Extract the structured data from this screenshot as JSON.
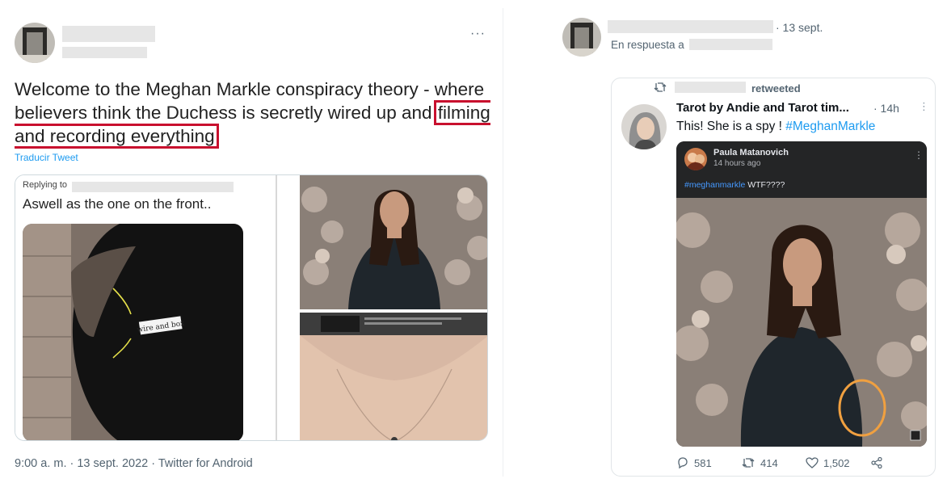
{
  "left_tweet": {
    "more_label": "···",
    "text_before": "Welcome to the Meghan Markle conspiracy theory - where believers think the Duchess is secretly wired up and ",
    "text_highlight": "filming and recording everything",
    "translate_label": "Traducir Tweet",
    "media": {
      "replying_to_label": "Replying to",
      "reply_text": "Aswell as the one on the front..",
      "annotation_label": "wire and box"
    },
    "meta": "9:00 a. m. · 13 sept. 2022 · Twitter for Android"
  },
  "right_tweet": {
    "date": "· 13 sept.",
    "in_reply_label": "En respuesta a",
    "quote": {
      "retweet_icon": "retweet-icon",
      "retweeted_label": "retweeted",
      "author": "Tarot by Andie and Tarot tim...",
      "time": "· 14h",
      "more_label": "⋮",
      "text": "This!  She is a spy ! ",
      "hashtag": "#MeghanMarkle",
      "embed": {
        "name": "Paula Matanovich",
        "time": "14 hours ago",
        "more_label": "⋮",
        "tag": "#meghanmarkle",
        "caption_rest": " WTF????"
      },
      "actions": {
        "replies": "581",
        "retweets": "414",
        "likes": "1,502"
      }
    }
  },
  "colors": {
    "highlight_box": "#c8102e",
    "link_blue": "#1d9bf0",
    "circle_annotation": "#f0a040"
  }
}
